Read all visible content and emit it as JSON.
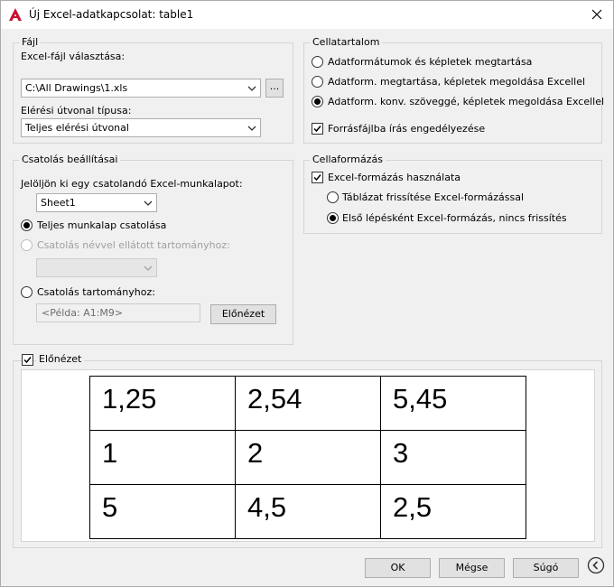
{
  "window": {
    "title": "Új Excel-adatkapcsolat: table1"
  },
  "file_group": {
    "title": "Fájl",
    "choose_label": "Excel-fájl választása:",
    "file_value": "C:\\All Drawings\\1.xls",
    "browse_label": "...",
    "path_type_label": "Elérési útvonal típusa:",
    "path_type_value": "Teljes elérési útvonal"
  },
  "cell_content": {
    "title": "Cellatartalom",
    "options": [
      "Adatformátumok és képletek megtartása",
      "Adatform. megtartása, képletek megoldása Excellel",
      "Adatform. konv. szöveggé, képletek megoldása Excellel"
    ],
    "selected": 2,
    "allow_write_label": "Forrásfájlba írás engedélyezése",
    "allow_write_checked": true
  },
  "link_settings": {
    "title": "Csatolás beállításai",
    "choose_sheet_label": "Jelöljön ki egy csatolandó Excel-munkalapot:",
    "sheet_value": "Sheet1",
    "option_full": "Teljes munkalap csatolása",
    "option_named": "Csatolás névvel ellátott tartományhoz:",
    "option_range": "Csatolás tartományhoz:",
    "range_placeholder": "<Példa: A1:M9>",
    "preview_button": "Előnézet"
  },
  "cell_format": {
    "title": "Cellaformázás",
    "use_excel_label": "Excel-formázás használata",
    "use_excel_checked": true,
    "option_refresh": "Táblázat frissítése Excel-formázással",
    "option_first": "Első lépésként Excel-formázás, nincs frissítés"
  },
  "preview": {
    "label": "Előnézet",
    "checked": true,
    "rows": [
      [
        "1,25",
        "2,54",
        "5,45"
      ],
      [
        "1",
        "2",
        "3"
      ],
      [
        "5",
        "4,5",
        "2,5"
      ]
    ]
  },
  "footer": {
    "ok": "OK",
    "cancel": "Mégse",
    "help": "Súgó"
  },
  "colors": {
    "app_icon": "#c8102e",
    "border": "#d5d5d5"
  },
  "icons": {
    "app": "autocad-logo-icon",
    "close": "close-icon",
    "nav": "circle-chevron-left-icon"
  }
}
